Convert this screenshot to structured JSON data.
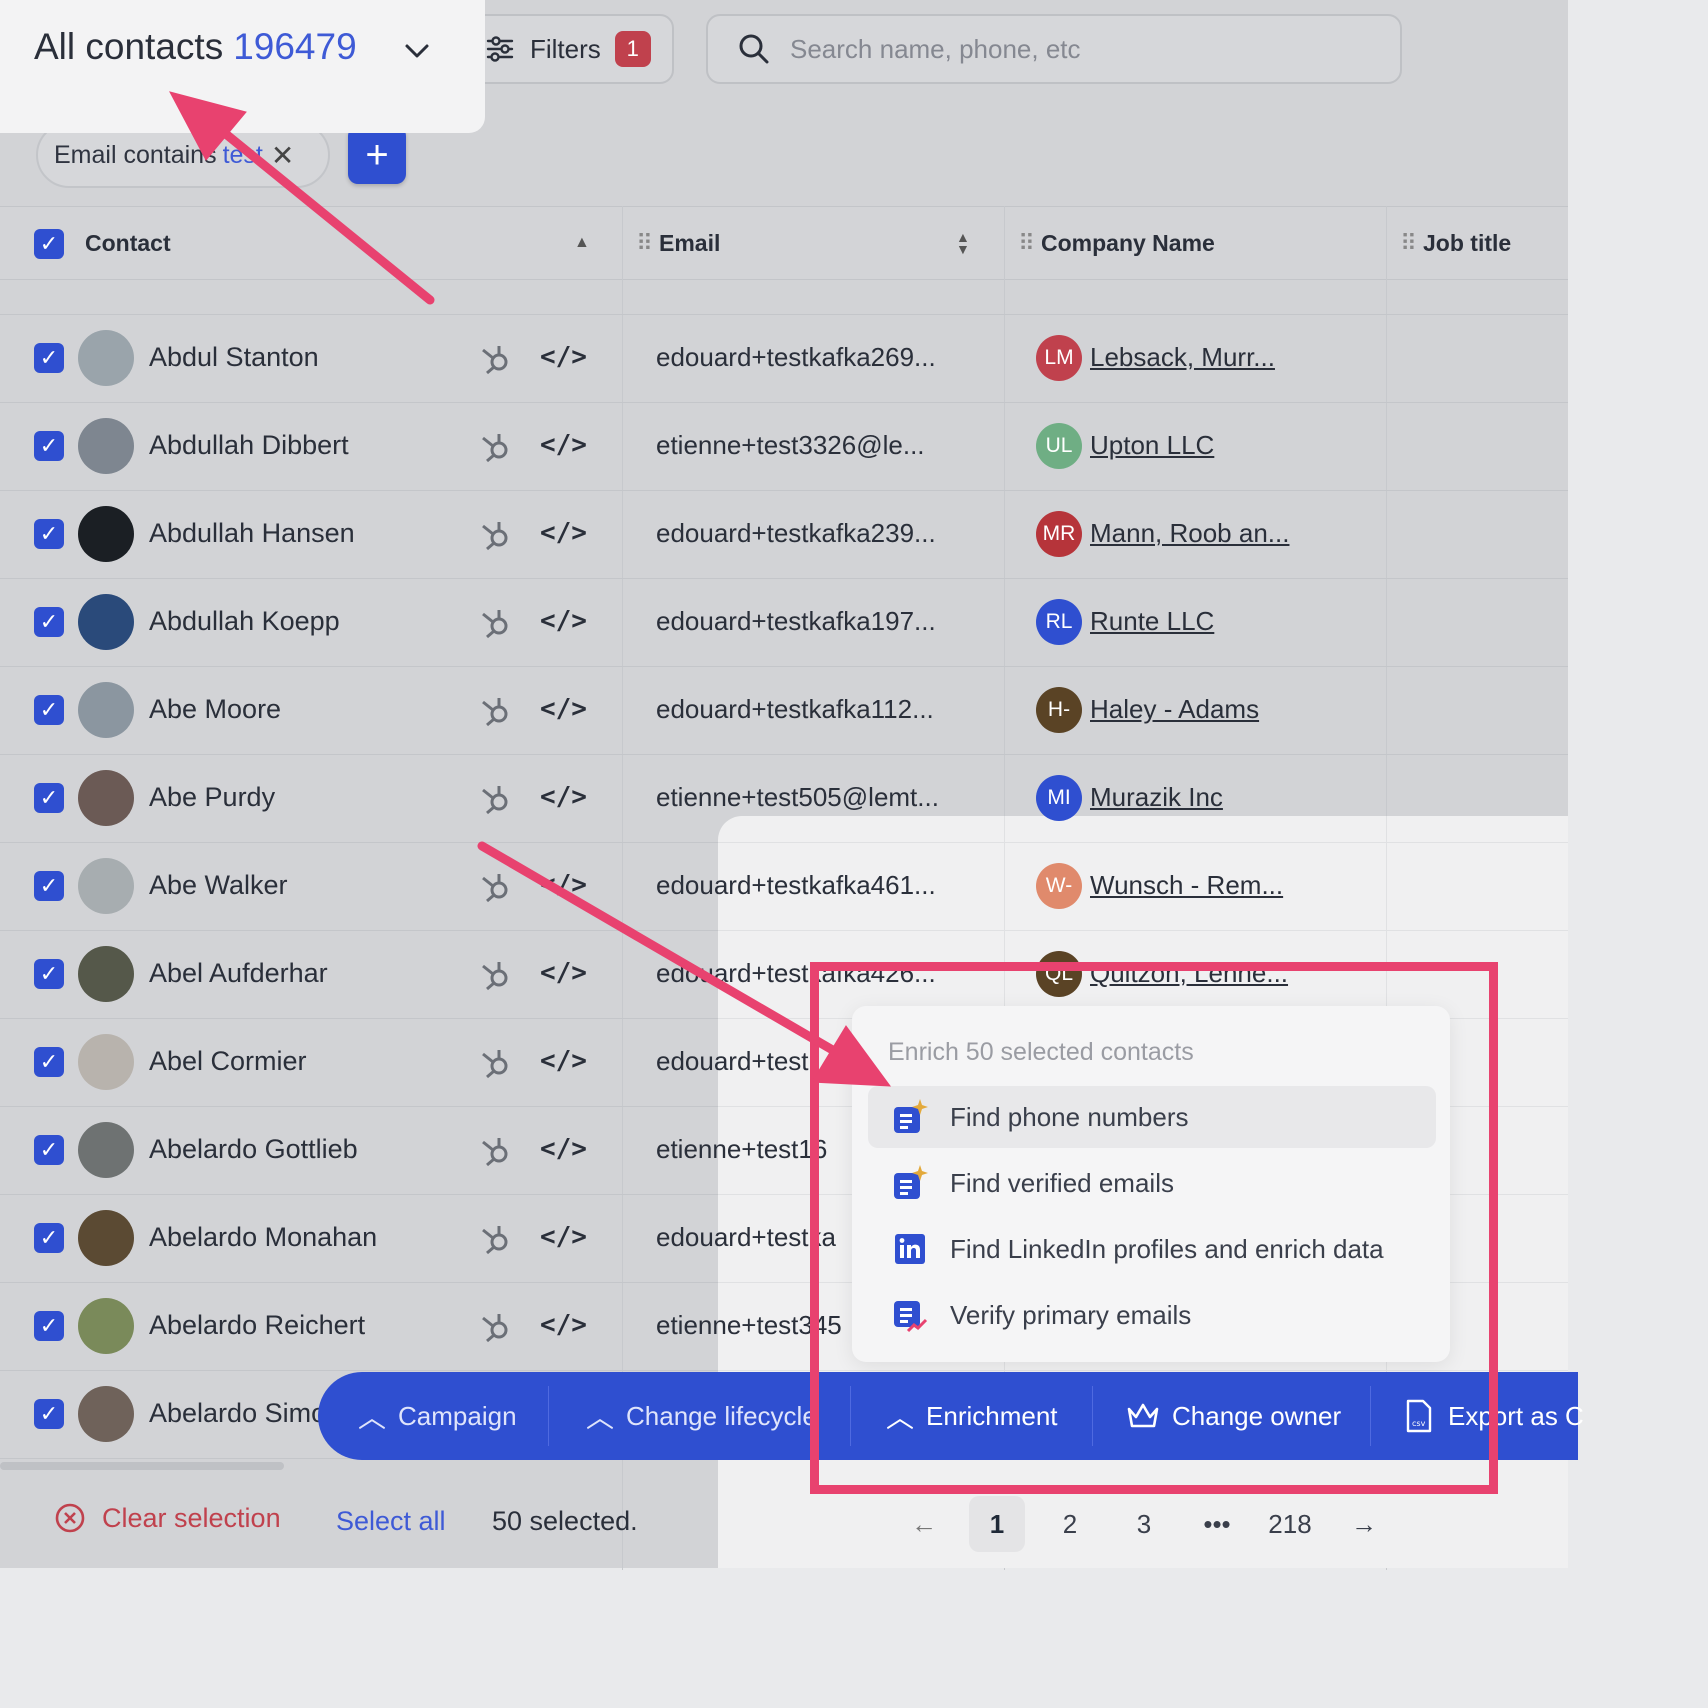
{
  "header": {
    "view_title": "All contacts",
    "view_count": "196479",
    "filters_label": "Filters",
    "filters_count": "1",
    "search_placeholder": "Search name, phone, etc"
  },
  "filter_chip": {
    "prefix": "Email contains",
    "value": "test",
    "remove": "✕"
  },
  "add_filter": "+",
  "columns": [
    "Contact",
    "Email",
    "Company Name",
    "Job title"
  ],
  "rows": [
    {
      "name": "Abdul Stanton",
      "email": "edouard+testkafka269...",
      "company_initials": "LM",
      "company": "Lebsack, Murr...",
      "company_color": "#c0414d"
    },
    {
      "name": "Abdullah Dibbert",
      "email": "etienne+test3326@le...",
      "company_initials": "UL",
      "company": "Upton LLC",
      "company_color": "#6fae84"
    },
    {
      "name": "Abdullah Hansen",
      "email": "edouard+testkafka239...",
      "company_initials": "MR",
      "company": "Mann, Roob an...",
      "company_color": "#b6343a"
    },
    {
      "name": "Abdullah Koepp",
      "email": "edouard+testkafka197...",
      "company_initials": "RL",
      "company": "Runte LLC",
      "company_color": "#2f4fd0"
    },
    {
      "name": "Abe Moore",
      "email": "edouard+testkafka112...",
      "company_initials": "H-",
      "company": "Haley - Adams",
      "company_color": "#5a4325"
    },
    {
      "name": "Abe Purdy",
      "email": "etienne+test505@lemt...",
      "company_initials": "MI",
      "company": "Murazik Inc",
      "company_color": "#2f4fd0"
    },
    {
      "name": "Abe Walker",
      "email": "edouard+testkafka461...",
      "company_initials": "W-",
      "company": "Wunsch - Rem...",
      "company_color": "#e08a6c"
    },
    {
      "name": "Abel Aufderhar",
      "email": "edouard+testkafka426...",
      "company_initials": "QL",
      "company": "Quitzon, Lehne...",
      "company_color": "#5a4325"
    },
    {
      "name": "Abel Cormier",
      "email": "edouard+test",
      "company_initials": "",
      "company": "",
      "company_color": ""
    },
    {
      "name": "Abelardo Gottlieb",
      "email": "etienne+test16",
      "company_initials": "",
      "company": "",
      "company_color": ""
    },
    {
      "name": "Abelardo Monahan",
      "email": "edouard+testka",
      "company_initials": "",
      "company": "",
      "company_color": ""
    },
    {
      "name": "Abelardo Reichert",
      "email": "etienne+test345",
      "company_initials": "",
      "company": "",
      "company_color": ""
    },
    {
      "name": "Abelardo Simo",
      "email": "",
      "company_initials": "",
      "company": "",
      "company_color": ""
    }
  ],
  "enrich_menu": {
    "header": "Enrich 50 selected contacts",
    "items": [
      {
        "label": "Find phone numbers",
        "icon": "sparkle-enrich-icon"
      },
      {
        "label": "Find verified emails",
        "icon": "sparkle-enrich-icon"
      },
      {
        "label": "Find LinkedIn profiles and enrich data",
        "icon": "linkedin-icon"
      },
      {
        "label": "Verify primary emails",
        "icon": "verify-email-icon"
      }
    ]
  },
  "action_bar": {
    "campaign": "Campaign",
    "lifecycle": "Change lifecycle",
    "enrichment": "Enrichment",
    "owner": "Change owner",
    "export": "Export as C"
  },
  "footer": {
    "clear_selection": "Clear selection",
    "select_all": "Select all",
    "selected": "50 selected.",
    "pages": [
      "1",
      "2",
      "3",
      "•••",
      "218"
    ],
    "current_page": "1"
  },
  "colors": {
    "accent": "#2f4fd0",
    "annotation": "#e8426f",
    "danger": "#c0414d"
  }
}
